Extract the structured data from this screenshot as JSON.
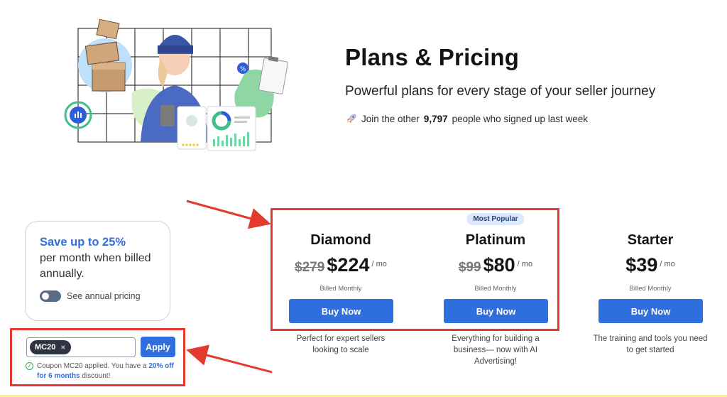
{
  "hero": {
    "title": "Plans & Pricing",
    "subtitle": "Powerful plans for every stage of your seller journey",
    "social_prefix": "Join the other",
    "social_count": "9,797",
    "social_suffix": "people who signed up last week"
  },
  "save_card": {
    "headline": "Save up to 25%",
    "body": "per month when billed annually.",
    "toggle_label": "See annual pricing",
    "toggle_on": false
  },
  "coupon": {
    "code": "MC20",
    "remove_symbol": "×",
    "apply_label": "Apply",
    "msg_prefix": "Coupon MC20 applied. You have a",
    "msg_highlight": "20% off for 6 months",
    "msg_suffix": "discount!"
  },
  "plans": [
    {
      "badge": "",
      "name": "Diamond",
      "old_price": "$279",
      "price": "$224",
      "per": "/ mo",
      "billed": "Billed Monthly",
      "cta": "Buy Now",
      "desc": "Perfect for expert sellers looking to scale"
    },
    {
      "badge": "Most Popular",
      "name": "Platinum",
      "old_price": "$99",
      "price": "$80",
      "per": "/ mo",
      "billed": "Billed Monthly",
      "cta": "Buy Now",
      "desc": "Everything for building a business— now with AI Advertising!"
    },
    {
      "badge": "",
      "name": "Starter",
      "old_price": "",
      "price": "$39",
      "per": "/ mo",
      "billed": "Billed Monthly",
      "cta": "Buy Now",
      "desc": "The training and tools you need to get started"
    }
  ],
  "colors": {
    "accent": "#2f6fdd",
    "highlight_red": "#e23a2e",
    "badge_bg": "#dce8fb",
    "success": "#35a853"
  },
  "icons": {
    "rocket": "rocket-icon",
    "check": "check-circle-icon",
    "close": "close-icon"
  }
}
